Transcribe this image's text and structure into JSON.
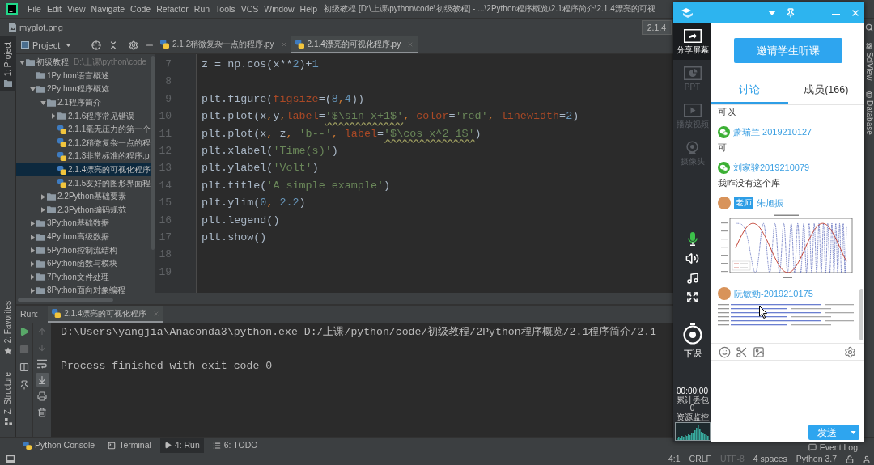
{
  "menu_bar": {
    "items": [
      "File",
      "Edit",
      "View",
      "Navigate",
      "Code",
      "Refactor",
      "Run",
      "Tools",
      "VCS",
      "Window",
      "Help"
    ],
    "title": "初级教程 [D:\\上课\\python\\code\\初级教程] - ...\\2Python程序概览\\2.1程序简介\\2.1.4漂亮的可视"
  },
  "navigation_bar": {
    "file": "myplot.png",
    "run_configuration": "2.1.4"
  },
  "tool_strip_left": {
    "top": [
      {
        "label": "1: Project",
        "kind": "project",
        "selected": true
      }
    ],
    "bottom": [
      {
        "label": "2: Favorites",
        "kind": "favorites",
        "selected": false
      },
      {
        "label": "Z: Structure",
        "kind": "structure",
        "selected": false
      }
    ]
  },
  "tool_strip_right": [
    {
      "label": "SciView",
      "kind": "sciview"
    },
    {
      "label": "Database",
      "kind": "database"
    }
  ],
  "project_panel": {
    "title": "Project",
    "tree": [
      {
        "label": "初级教程",
        "hint": "D:\\上课\\python\\code",
        "kind": "folder",
        "expanded": true,
        "selected": false,
        "children": [
          {
            "label": "1Python语言概述",
            "kind": "empty_folder",
            "selected": false
          },
          {
            "label": "2Python程序概览",
            "kind": "folder",
            "expanded": true,
            "selected": false,
            "children": [
              {
                "label": "2.1程序简介",
                "kind": "folder",
                "expanded": true,
                "selected": false,
                "children": [
                  {
                    "label": "2.1.6程序常见错误",
                    "kind": "folder",
                    "expanded": false,
                    "selected": false
                  },
                  {
                    "label": "2.1.1毫无压力的第一个",
                    "kind": "file",
                    "selected": false
                  },
                  {
                    "label": "2.1.2稍微复杂一点的程",
                    "kind": "file",
                    "selected": false
                  },
                  {
                    "label": "2.1.3非常标准的程序.p",
                    "kind": "file",
                    "selected": false
                  },
                  {
                    "label": "2.1.4漂亮的可视化程序",
                    "kind": "file",
                    "selected": true
                  },
                  {
                    "label": "2.1.5友好的图形界面程",
                    "kind": "file",
                    "selected": false
                  }
                ]
              },
              {
                "label": "2.2Python基础要素",
                "kind": "folder",
                "expanded": false,
                "selected": false
              },
              {
                "label": "2.3Python编码规范",
                "kind": "folder",
                "expanded": false,
                "selected": false
              }
            ]
          },
          {
            "label": "3Python基础数据",
            "kind": "folder",
            "expanded": false,
            "selected": false
          },
          {
            "label": "4Python高级数据",
            "kind": "folder",
            "expanded": false,
            "selected": false
          },
          {
            "label": "5Python控制流结构",
            "kind": "folder",
            "expanded": false,
            "selected": false
          },
          {
            "label": "6Python函数与模块",
            "kind": "folder",
            "expanded": false,
            "selected": false
          },
          {
            "label": "7Python文件处理",
            "kind": "folder",
            "expanded": false,
            "selected": false
          },
          {
            "label": "8Python面向对象编程",
            "kind": "folder",
            "expanded": false,
            "selected": false
          }
        ]
      }
    ]
  },
  "editor": {
    "tabs": [
      {
        "label": "2.1.2稍微复杂一点的程序.py",
        "selected": false
      },
      {
        "label": "2.1.4漂亮的可视化程序.py",
        "selected": true
      }
    ],
    "lines": [
      {
        "number": "7",
        "tokens": [
          {
            "kind": "plain",
            "text": "z = np.cos(x**"
          },
          {
            "kind": "number",
            "text": "2"
          },
          {
            "kind": "plain",
            "text": ")+"
          },
          {
            "kind": "number",
            "text": "1"
          }
        ]
      },
      {
        "number": "8"
      },
      {
        "number": "9",
        "tokens": [
          {
            "kind": "plain",
            "text": "plt.figure("
          },
          {
            "kind": "param",
            "text": "figsize"
          },
          {
            "kind": "plain",
            "text": "=("
          },
          {
            "kind": "number",
            "text": "8"
          },
          {
            "kind": "comma",
            "text": ","
          },
          {
            "kind": "number",
            "text": "4"
          },
          {
            "kind": "plain",
            "text": "))"
          }
        ]
      },
      {
        "number": "10",
        "tokens": [
          {
            "kind": "plain",
            "text": "plt.plot(x"
          },
          {
            "kind": "comma",
            "text": ","
          },
          {
            "kind": "plain",
            "text": "y"
          },
          {
            "kind": "comma",
            "text": ","
          },
          {
            "kind": "param",
            "text": "label"
          },
          {
            "kind": "plain",
            "text": "="
          },
          {
            "kind": "string_warn",
            "text": "'$\\sin x+1$'"
          },
          {
            "kind": "comma",
            "text": ", "
          },
          {
            "kind": "param",
            "text": "color"
          },
          {
            "kind": "plain",
            "text": "="
          },
          {
            "kind": "string",
            "text": "'red'"
          },
          {
            "kind": "comma",
            "text": ", "
          },
          {
            "kind": "param",
            "text": "linewidth"
          },
          {
            "kind": "plain",
            "text": "="
          },
          {
            "kind": "number",
            "text": "2"
          },
          {
            "kind": "plain",
            "text": ")"
          }
        ]
      },
      {
        "number": "11",
        "tokens": [
          {
            "kind": "plain",
            "text": "plt.plot(x"
          },
          {
            "kind": "comma",
            "text": ", "
          },
          {
            "kind": "plain",
            "text": "z"
          },
          {
            "kind": "comma",
            "text": ", "
          },
          {
            "kind": "string",
            "text": "'b--'"
          },
          {
            "kind": "comma",
            "text": ", "
          },
          {
            "kind": "param",
            "text": "label"
          },
          {
            "kind": "plain",
            "text": "="
          },
          {
            "kind": "string_warn",
            "text": "'$\\cos x^2+1$'"
          },
          {
            "kind": "plain",
            "text": ")"
          }
        ]
      },
      {
        "number": "12",
        "tokens": [
          {
            "kind": "plain",
            "text": "plt.xlabel("
          },
          {
            "kind": "string",
            "text": "'Time(s)'"
          },
          {
            "kind": "plain",
            "text": ")"
          }
        ]
      },
      {
        "number": "13",
        "tokens": [
          {
            "kind": "plain",
            "text": "plt.ylabel("
          },
          {
            "kind": "string",
            "text": "'Volt'"
          },
          {
            "kind": "plain",
            "text": ")"
          }
        ]
      },
      {
        "number": "14",
        "tokens": [
          {
            "kind": "plain",
            "text": "plt.title("
          },
          {
            "kind": "string",
            "text": "'A simple example'"
          },
          {
            "kind": "plain",
            "text": ")"
          }
        ]
      },
      {
        "number": "15",
        "tokens": [
          {
            "kind": "plain",
            "text": "plt.ylim("
          },
          {
            "kind": "number",
            "text": "0"
          },
          {
            "kind": "comma",
            "text": ", "
          },
          {
            "kind": "number",
            "text": "2.2"
          },
          {
            "kind": "plain",
            "text": ")"
          }
        ]
      },
      {
        "number": "16",
        "tokens": [
          {
            "kind": "plain",
            "text": "plt.legend()"
          }
        ]
      },
      {
        "number": "17",
        "tokens": [
          {
            "kind": "plain",
            "text": "plt.show()"
          }
        ]
      },
      {
        "number": "18"
      },
      {
        "number": "19"
      }
    ]
  },
  "run_panel": {
    "label": "Run:",
    "tab": "2.1.4漂亮的可视化程序",
    "tools_left": [
      {
        "kind": "rerun",
        "disabled": false
      },
      {
        "kind": "stop",
        "disabled": true
      },
      {
        "kind": "layout",
        "disabled": false
      },
      {
        "kind": "pin",
        "disabled": false
      }
    ],
    "tools_right": [
      {
        "kind": "up",
        "disabled": true,
        "on": false
      },
      {
        "kind": "down",
        "disabled": true,
        "on": false
      },
      {
        "kind": "soft_wrap",
        "disabled": false,
        "on": false
      },
      {
        "kind": "scroll_to_end",
        "disabled": false,
        "on": true
      },
      {
        "kind": "print",
        "disabled": false,
        "on": false
      },
      {
        "kind": "clear",
        "disabled": false,
        "on": false
      }
    ],
    "output": [
      "D:\\Users\\yangjia\\Anaconda3\\python.exe D:/上课/python/code/初级教程/2Python程序概览/2.1程序简介/2.1",
      "Process finished with exit code 0"
    ]
  },
  "bottom_tabs": [
    {
      "label": "Python Console",
      "kind": "console",
      "selected": false
    },
    {
      "label": "Terminal",
      "kind": "terminal",
      "selected": false
    },
    {
      "label": "4: Run",
      "kind": "run",
      "selected": true
    },
    {
      "label": "6: TODO",
      "kind": "todo",
      "selected": false
    }
  ],
  "event_log": "Event Log",
  "status_bar": [
    {
      "text": "4:1",
      "disabled": false
    },
    {
      "text": "CRLF",
      "disabled": false
    },
    {
      "text": "UTF-8",
      "disabled": true
    },
    {
      "text": "4 spaces",
      "disabled": false
    },
    {
      "text": "Python 3.7",
      "disabled": false
    }
  ],
  "chat_window": {
    "share_tools": [
      {
        "label": "分享屏幕",
        "kind": "screen",
        "selected": true,
        "disabled": false
      },
      {
        "label": "PPT",
        "kind": "ppt",
        "selected": false,
        "disabled": true
      },
      {
        "label": "播放视频",
        "kind": "video",
        "selected": false,
        "disabled": true
      },
      {
        "label": "摄像头",
        "kind": "camera",
        "selected": false,
        "disabled": true
      }
    ],
    "microphone": {
      "on": true
    },
    "media_controls": [
      {
        "kind": "speaker"
      },
      {
        "kind": "music"
      },
      {
        "kind": "fullscreen"
      }
    ],
    "end_class_button": "下课",
    "timer": "00:00:00",
    "packet_loss_label": "累计丢包",
    "packet_loss": "0",
    "resource_monitor_link": "资源监控",
    "invite_button": "邀请学生听课",
    "tabs": [
      {
        "label": "讨论",
        "selected": true
      },
      {
        "label": "成员(166)",
        "selected": false
      }
    ],
    "messages": [
      {
        "body": {
          "kind": "text",
          "text": "可以"
        }
      },
      {
        "sender": {
          "kind": "wechat",
          "name": "萧瑞兰 2019210127"
        },
        "body": {
          "kind": "text",
          "text": "可"
        }
      },
      {
        "sender": {
          "kind": "wechat",
          "name": "刘家骏2019210079"
        },
        "body": {
          "kind": "text",
          "text": "我咋没有这个库"
        }
      },
      {
        "sender": {
          "kind": "photo",
          "badge": "老师",
          "name": "朱旭振"
        },
        "body": {
          "kind": "plot_image"
        }
      },
      {
        "sender": {
          "kind": "photo",
          "name": "阮敏勁-2019210175"
        },
        "body": {
          "kind": "traceback_image"
        }
      }
    ],
    "send_button": "发送"
  }
}
